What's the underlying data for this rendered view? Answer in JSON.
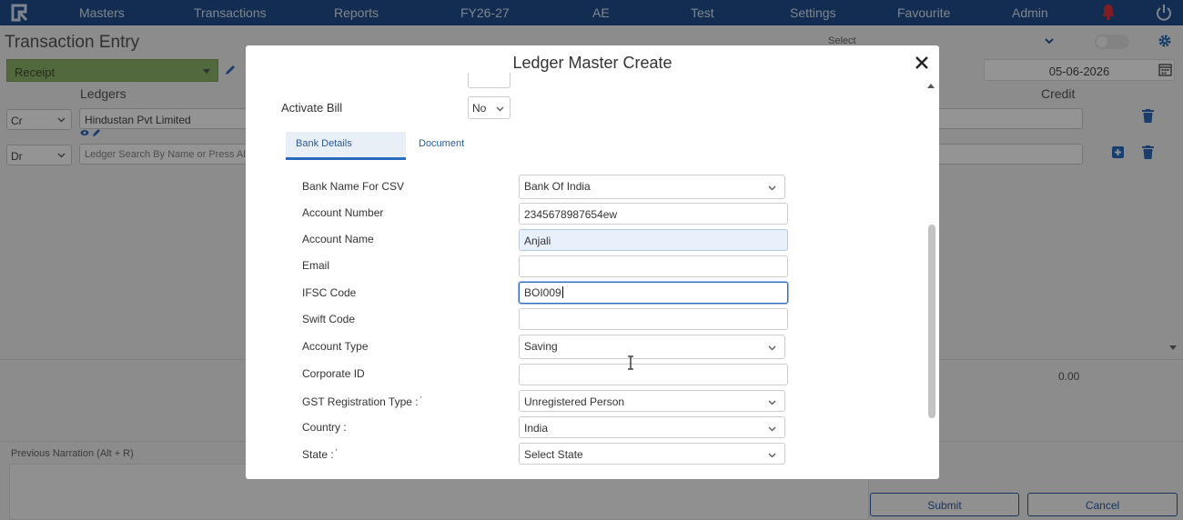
{
  "nav": {
    "items": [
      "Masters",
      "Transactions",
      "Reports",
      "FY26-27",
      "AE",
      "Test",
      "Settings",
      "Favourite",
      "Admin"
    ]
  },
  "page": {
    "title": "Transaction Entry",
    "top_select": "Select",
    "voucher_type": "Receipt",
    "date": "05-06-2026",
    "col_ledgers": "Ledgers",
    "col_credit": "Credit",
    "rows": [
      {
        "type": "Cr",
        "ledger": "Hindustan Pvt Limited"
      },
      {
        "type": "Dr",
        "ledger_placeholder": "Ledger Search By Name or Press Alt + C"
      }
    ],
    "total_credit": "0.00",
    "narration_label": "Previous Narration (Alt + R)",
    "submit": "Submit",
    "cancel": "Cancel"
  },
  "modal": {
    "title": "Ledger Master Create",
    "activate_bill_label": "Activate Bill",
    "activate_bill_value": "No",
    "tabs": [
      "Bank Details",
      "Document"
    ],
    "fields": {
      "bank_name_label": "Bank Name For CSV",
      "bank_name_value": "Bank Of India",
      "account_number_label": "Account Number",
      "account_number_value": "2345678987654ew",
      "account_name_label": "Account Name",
      "account_name_value": "Anjali",
      "email_label": "Email",
      "email_value": "",
      "ifsc_label": "IFSC Code",
      "ifsc_value": "BOI009",
      "swift_label": "Swift Code",
      "swift_value": "",
      "account_type_label": "Account Type",
      "account_type_value": "Saving",
      "corporate_id_label": "Corporate ID",
      "corporate_id_value": "",
      "gst_type_label": "GST Registration Type :",
      "gst_type_value": "Unregistered Person",
      "country_label": "Country :",
      "country_value": "India",
      "state_label": "State :",
      "state_value": "Select State"
    }
  },
  "colors": {
    "nav_bg": "#1f4e8c",
    "voucher_green": "#8eb66a",
    "accent_blue": "#2a6bbf",
    "bell_red": "#e0343a"
  }
}
